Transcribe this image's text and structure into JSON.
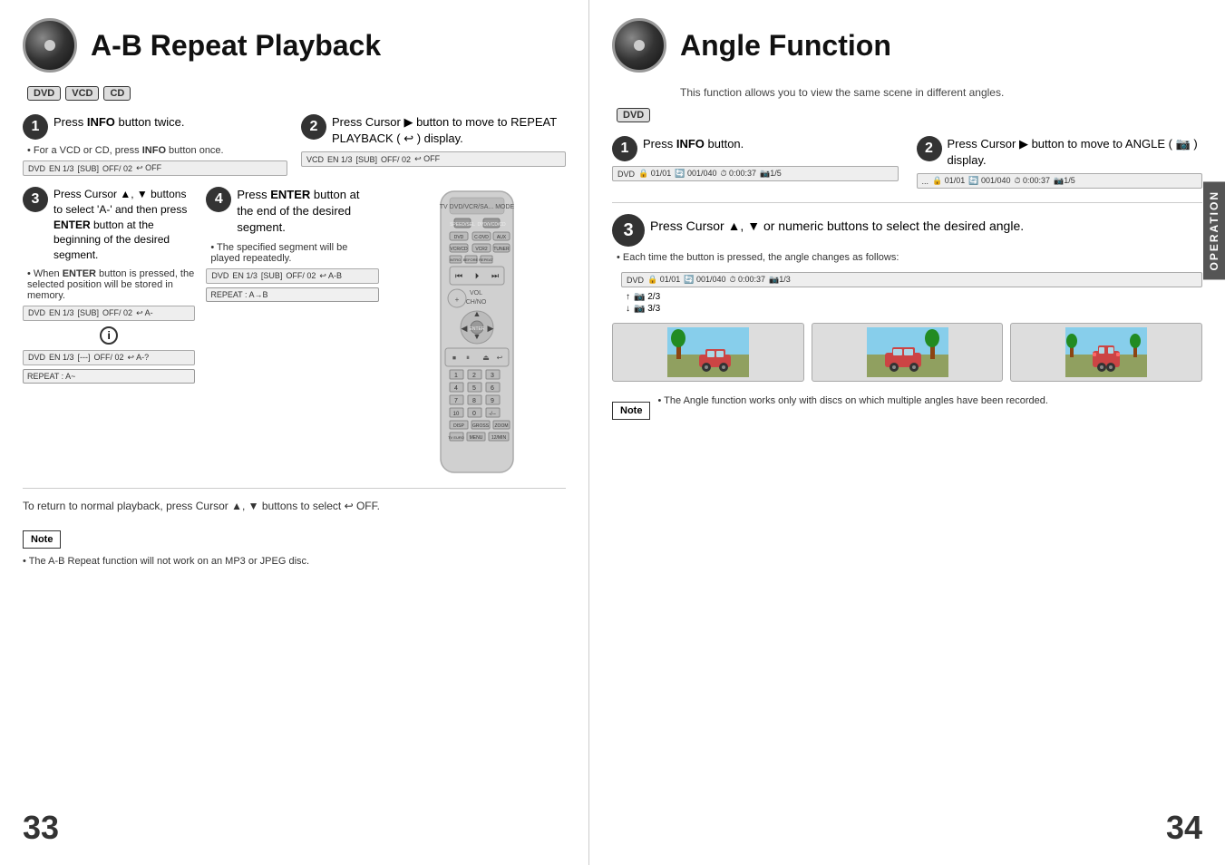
{
  "left_page": {
    "title": "A-B Repeat Playback",
    "page_number": "33",
    "formats": [
      "DVD",
      "VCD",
      "CD"
    ],
    "step1": {
      "number": "1",
      "text": "Press INFO button twice.",
      "note": "• For a VCD or CD, press INFO button once.",
      "status": "DVD  EN 1/3  [SUB]  OFF/ 02  ↩ OFF"
    },
    "step2": {
      "number": "2",
      "text": "Press Cursor ▶ button to move to REPEAT PLAYBACK ( ↩ ) display.",
      "status": "VCD  EN 1/3  [SUB]  OFF/ 02  ↩ OFF"
    },
    "step3": {
      "number": "3",
      "text": "Press Cursor ▲, ▼ buttons to select 'A-' and then press ENTER button at the beginning of the desired segment.",
      "note1": "• When ENTER button is pressed, the selected position will be stored in memory.",
      "status1": "DVD  EN 1/3  [SUB]  OFF/ 02  ↩ A-",
      "info_symbol": "🛈",
      "status2": "DVD  EN 1/3  [---]  OFF/ 02  ↩ A-?",
      "repeat1": "REPEAT : A~"
    },
    "step4": {
      "number": "4",
      "text": "Press ENTER button at the end of the desired segment.",
      "note": "• The specified segment will be played repeatedly.",
      "status": "DVD  EN 1/3  [SUB]  OFF/ 02  ↩ A-B",
      "repeat": "REPEAT : A→B"
    },
    "return_note": "To return to normal playback, press Cursor ▲, ▼ buttons to select ↩ OFF.",
    "note_label": "Note",
    "note_text": "• The A-B Repeat function will not work on an MP3 or JPEG disc."
  },
  "right_page": {
    "title": "Angle Function",
    "page_number": "34",
    "subtitle": "This function allows you to view the same scene in different angles.",
    "format": "DVD",
    "step1": {
      "number": "1",
      "text": "Press INFO button.",
      "status": "DVD  🔒 01/01  🔄 001/040  ⏱ 0:00:37  📷1/5"
    },
    "step2": {
      "number": "2",
      "text": "Press Cursor ▶ button to move to ANGLE ( 📷 ) display.",
      "status": "...  🔒 01/01  🔄 001/040  ⏱ 0:00:37  📷1/5"
    },
    "step3": {
      "number": "3",
      "text": "Press Cursor ▲, ▼ or numeric buttons to select the desired angle.",
      "note": "• Each time the button is pressed, the angle changes as follows:",
      "status": "DVD  🔒 01/01  🔄 001/040  ⏱ 0:00:37  📷1/3",
      "angle_label1": "📷 2/3",
      "angle_label2": "📷 3/3",
      "images": [
        "Car angle 1",
        "Car angle 2",
        "Car angle 3"
      ]
    },
    "note_label": "Note",
    "note_text": "• The Angle function works only with discs on which multiple angles have been recorded.",
    "operation_tab": "OPERATION"
  }
}
